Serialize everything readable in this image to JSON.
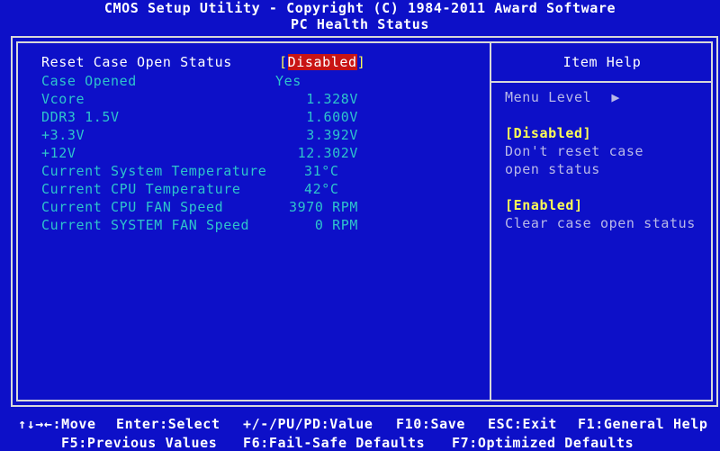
{
  "header": {
    "title": "CMOS Setup Utility - Copyright (C) 1984-2011 Award Software",
    "subtitle": "PC Health Status"
  },
  "settings": {
    "reset_case": {
      "label": "Reset Case Open Status",
      "open_bracket": "[",
      "value": "Disabled",
      "close_bracket": "]"
    },
    "items": [
      {
        "label": "Case Opened",
        "value": "Yes"
      },
      {
        "label": "Vcore",
        "value": "1.328V"
      },
      {
        "label": "DDR3 1.5V",
        "value": "1.600V"
      },
      {
        "label": "+3.3V",
        "value": "3.392V"
      },
      {
        "label": "+12V",
        "value": "12.302V"
      },
      {
        "label": "Current System Temperature",
        "value": "31°C"
      },
      {
        "label": "Current CPU Temperature",
        "value": "42°C"
      },
      {
        "label": "Current CPU FAN Speed",
        "value": "3970 RPM"
      },
      {
        "label": "Current SYSTEM FAN Speed",
        "value": "0 RPM"
      }
    ]
  },
  "help": {
    "title": "Item Help",
    "menu_level": "Menu Level",
    "menu_level_arrow": "▶",
    "disabled_tag": "[Disabled]",
    "disabled_line1": "Don't reset case",
    "disabled_line2": "open status",
    "enabled_tag": "[Enabled]",
    "enabled_line1": "Clear case open status"
  },
  "footer": {
    "row1": [
      "↑↓→←:Move",
      "Enter:Select",
      "+/-/PU/PD:Value",
      "F10:Save",
      "ESC:Exit",
      "F1:General Help"
    ],
    "row2": [
      "F5:Previous Values",
      "F6:Fail-Safe Defaults",
      "F7:Optimized Defaults"
    ]
  },
  "colors": {
    "background": "#0d10c8",
    "item_text": "#2ec4cc",
    "selected_label": "#ffffff",
    "highlight": "#c81414",
    "help_heading": "#ffff55"
  }
}
